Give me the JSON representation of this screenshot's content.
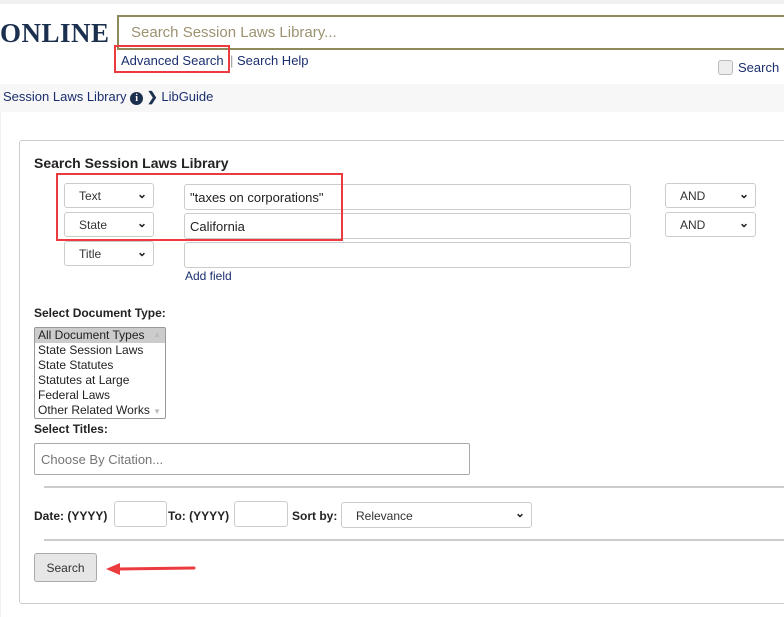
{
  "header": {
    "logo": "ONLINE",
    "search_placeholder": "Search Session Laws Library...",
    "advanced_search": "Advanced Search",
    "separator": "|",
    "search_help": "Search Help",
    "checkbox_label": "Search ."
  },
  "breadcrumb": {
    "items": [
      "Session Laws Library",
      "LibGuide"
    ]
  },
  "form": {
    "title": "Search Session Laws Library",
    "rows": [
      {
        "field": "Text",
        "value": "\"taxes on corporations\"",
        "operator": "AND"
      },
      {
        "field": "State",
        "value": "California",
        "operator": "AND"
      },
      {
        "field": "Title",
        "value": ""
      }
    ],
    "add_field": "Add field",
    "doc_type_label": "Select Document Type:",
    "doc_types": [
      "All Document Types",
      "State Session Laws",
      "State Statutes",
      "Statutes at Large",
      "Federal Laws",
      "Other Related Works"
    ],
    "titles_label": "Select Titles:",
    "titles_placeholder": "Choose By Citation...",
    "date_label": "Date: (YYYY)",
    "to_label": "To: (YYYY)",
    "sort_label": "Sort by:",
    "sort_value": "Relevance",
    "search_button": "Search"
  },
  "colors": {
    "annotation": "#ec3b3f",
    "link": "#1b2f6e",
    "search_border": "#8e8a5b"
  }
}
